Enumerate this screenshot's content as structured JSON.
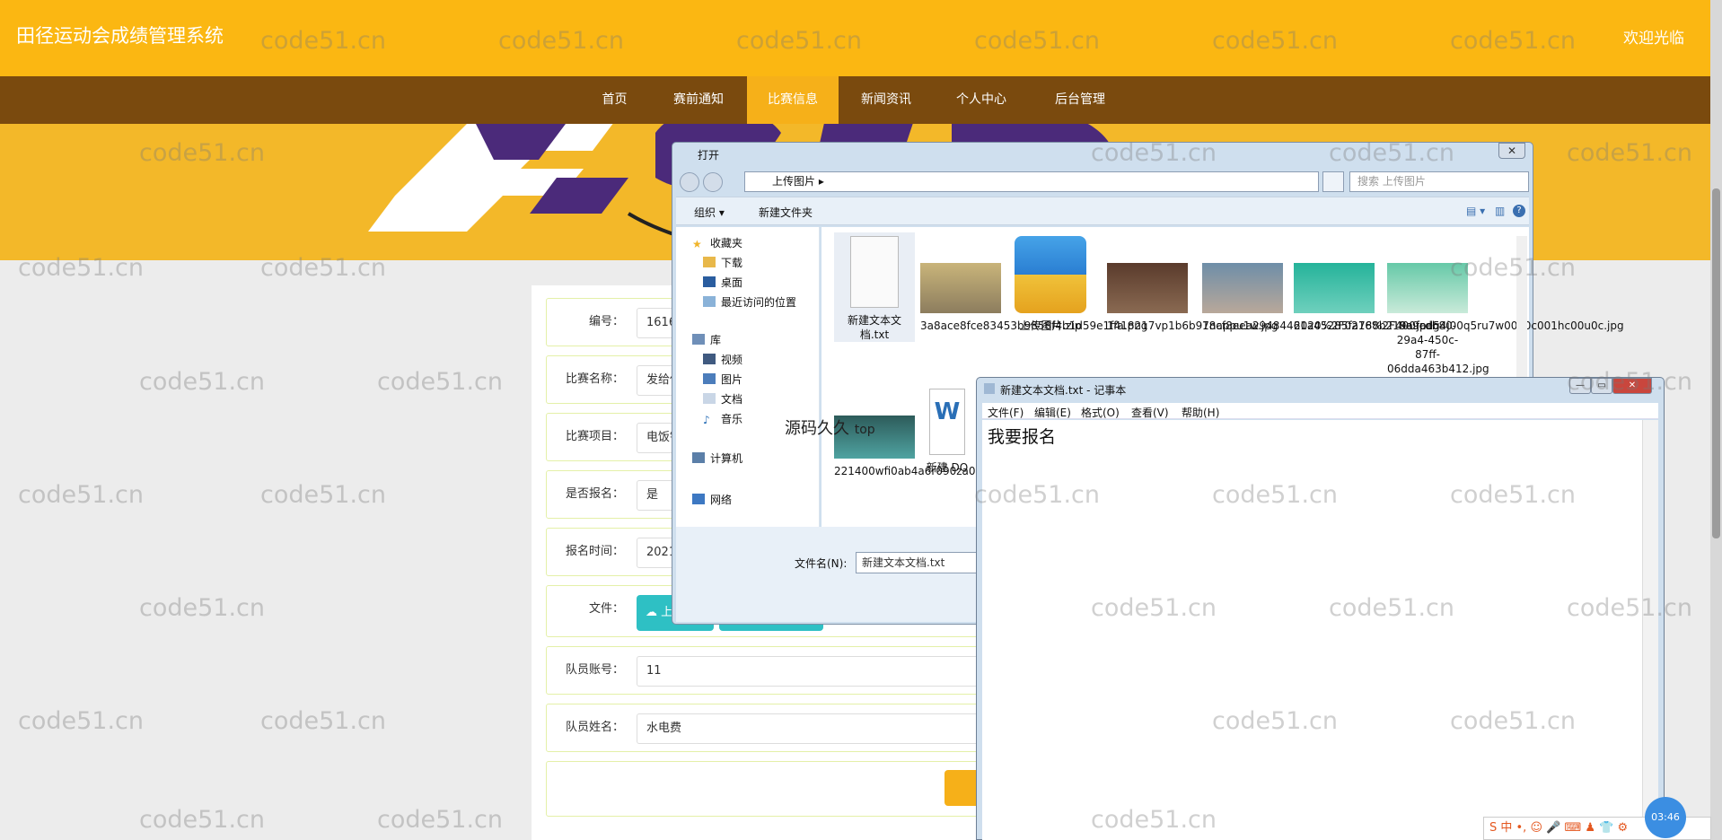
{
  "header": {
    "title": "田径运动会成绩管理系统",
    "welcome": "欢迎光临"
  },
  "nav": [
    {
      "label": "首页"
    },
    {
      "label": "赛前通知"
    },
    {
      "label": "比赛信息",
      "active": true
    },
    {
      "label": "新闻资讯"
    },
    {
      "label": "个人中心"
    },
    {
      "label": "后台管理"
    }
  ],
  "form": {
    "fields": [
      {
        "label": "编号：",
        "value": "1616"
      },
      {
        "label": "比赛名称：",
        "value": "发给你"
      },
      {
        "label": "比赛项目：",
        "value": "电饭锅"
      },
      {
        "label": "是否报名：",
        "value": "是"
      },
      {
        "label": "报名时间：",
        "value": "2021"
      },
      {
        "label": "文件：",
        "upload_label": "上传"
      },
      {
        "label": "队员账号：",
        "value": "11"
      },
      {
        "label": "队员姓名：",
        "value": "水电费"
      }
    ]
  },
  "open_dialog": {
    "title": "打开",
    "path": "上传图片",
    "search_placeholder": "搜索 上传图片",
    "toolbar": {
      "organize": "组织 ▾",
      "new_folder": "新建文件夹"
    },
    "nav_pane": [
      {
        "label": "收藏夹",
        "icon": "star-icon"
      },
      {
        "label": "下载",
        "icon": "download-folder-icon"
      },
      {
        "label": "桌面",
        "icon": "desktop-icon"
      },
      {
        "label": "最近访问的位置",
        "icon": "recent-icon"
      },
      {
        "label": "库",
        "icon": "library-icon"
      },
      {
        "label": "视频",
        "icon": "video-icon"
      },
      {
        "label": "图片",
        "icon": "pictures-icon"
      },
      {
        "label": "文档",
        "icon": "documents-icon"
      },
      {
        "label": "音乐",
        "icon": "music-icon"
      },
      {
        "label": "计算机",
        "icon": "computer-icon"
      },
      {
        "label": "网络",
        "icon": "network-icon"
      }
    ],
    "files": [
      {
        "name": "新建文本文档.txt"
      },
      {
        "name": "3a8ace8fce83453b9858f4b1d59e1ffa.png"
      },
      {
        "name": "上传图片.zip"
      },
      {
        "name": "1418217vp1b6b97nappu1w.jpg"
      },
      {
        "name": "18cf8eea29484461a45285fa788b219a.jpeg"
      },
      {
        "name": "2020%2F0216%2F400fad54j00q5ru7w00a0c001hc00u0c.jpg"
      },
      {
        "name": "8e9cdb80-29a4-450c-87ff-06dda463b412.jpg"
      },
      {
        "name": "221400wfi0ab4a6r090za0.jpg"
      },
      {
        "name": "新建 DO"
      }
    ],
    "filename_label": "文件名(N):",
    "filename_value": "新建文本文档.txt"
  },
  "notepad": {
    "title": "新建文本文档.txt - 记事本",
    "menu": [
      "文件(F)",
      "编辑(E)",
      "格式(O)",
      "查看(V)",
      "帮助(H)"
    ],
    "content": "我要报名"
  },
  "overlay": {
    "text": "源码久久",
    "suffix": "top"
  },
  "watermark": "code51.cn",
  "taskbar": {
    "clock": "03:46",
    "ime": "S 中 •, ☺ 🎤 ⌨ ♟ 👕 ⚙"
  },
  "colors": {
    "header": "#fbb712",
    "nav": "#7a4a0e",
    "nav_active": "#f6b019",
    "upload": "#2ec0c4"
  }
}
